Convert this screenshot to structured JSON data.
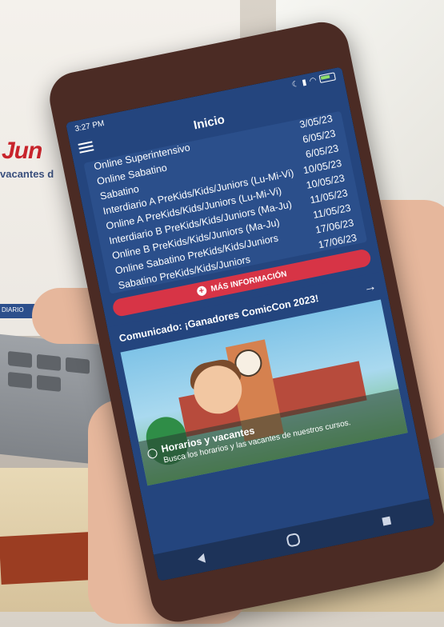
{
  "background": {
    "brand_text": "Jun",
    "sub_text": "vacantes d",
    "bar_text": "DIARIO"
  },
  "status_bar": {
    "time": "3:27 PM",
    "icons": [
      "moon-icon",
      "signal-icon",
      "wifi-icon",
      "battery-icon"
    ]
  },
  "app_bar": {
    "title": "Inicio",
    "menu_icon": "hamburger-menu-icon"
  },
  "schedule": [
    {
      "name": "Online Superintensivo",
      "date": "3/05/23"
    },
    {
      "name": "Online Sabatino",
      "date": "6/05/23"
    },
    {
      "name": "Sabatino",
      "date": "6/05/23"
    },
    {
      "name": "Interdiario A PreKids/Kids/Juniors (Lu-Mi-Vi)",
      "date": "10/05/23"
    },
    {
      "name": "Online A PreKids/Kids/Juniors (Lu-Mi-Vi)",
      "date": "10/05/23"
    },
    {
      "name": "Interdiario B PreKids/Kids/Juniors (Ma-Ju)",
      "date": "11/05/23"
    },
    {
      "name": "Online B PreKids/Kids/Juniors (Ma-Ju)",
      "date": "11/05/23"
    },
    {
      "name": "Online Sabatino PreKids/Kids/Juniors",
      "date": "17/06/23"
    },
    {
      "name": "Sabatino PreKids/Kids/Juniors",
      "date": "17/06/23"
    }
  ],
  "more_button": {
    "label": "MÁS INFORMACIÓN",
    "icon": "plus-circle-icon"
  },
  "comunicado": {
    "label": "Comunicado: ¡Ganadores ComicCon 2023!",
    "icon": "arrow-right-icon"
  },
  "banner": {
    "title": "Horarios y vacantes",
    "description": "Busca los horarios y las vacantes de nuestros cursos."
  },
  "nav": {
    "back": "back-triangle-icon",
    "home": "home-circle-icon",
    "recent": "recent-square-icon"
  },
  "colors": {
    "app_blue": "#24457e",
    "card_blue": "#2b4f8b",
    "button_red": "#d73446",
    "phone_body": "#4b2b24"
  }
}
